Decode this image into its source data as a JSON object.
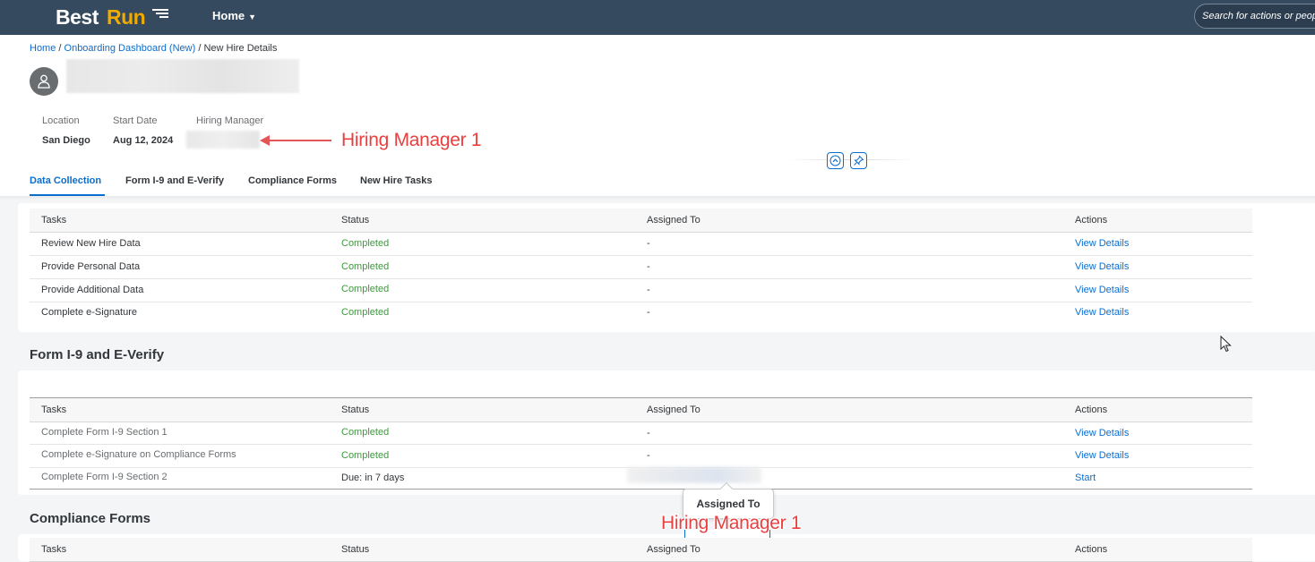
{
  "shell": {
    "logo_best": "Best",
    "logo_run": "Run",
    "home_label": "Home",
    "search_placeholder": "Search for actions or people"
  },
  "breadcrumb": {
    "home": "Home",
    "sep1": " / ",
    "dashboard": "Onboarding Dashboard (New)",
    "sep2": " / ",
    "current": "New Hire Details"
  },
  "attributes": {
    "location_label": "Location",
    "location_value": "San Diego",
    "start_date_label": "Start Date",
    "start_date_value": "Aug 12, 2024",
    "hiring_manager_label": "Hiring Manager"
  },
  "annotations": {
    "header_note": "Hiring Manager 1",
    "tooltip_note": "Hiring Manager 1"
  },
  "tabs": [
    {
      "label": "Data Collection",
      "active": true
    },
    {
      "label": "Form I-9 and E-Verify",
      "active": false
    },
    {
      "label": "Compliance Forms",
      "active": false
    },
    {
      "label": "New Hire Tasks",
      "active": false
    }
  ],
  "columns": {
    "tasks": "Tasks",
    "status": "Status",
    "assigned_to": "Assigned To",
    "actions": "Actions"
  },
  "data_collection": {
    "rows": [
      {
        "task": "Review New Hire Data",
        "status": "Completed",
        "assigned": "-",
        "action": "View Details"
      },
      {
        "task": "Provide Personal Data",
        "status": "Completed",
        "assigned": "-",
        "action": "View Details"
      },
      {
        "task": "Provide Additional Data",
        "status": "Completed",
        "assigned": "-",
        "action": "View Details"
      },
      {
        "task": "Complete e-Signature",
        "status": "Completed",
        "assigned": "-",
        "action": "View Details"
      }
    ]
  },
  "form_i9": {
    "title": "Form I-9 and E-Verify",
    "rows": [
      {
        "task": "Complete Form I-9 Section 1",
        "status": "Completed",
        "assigned": "-",
        "action": "View Details"
      },
      {
        "task": "Complete e-Signature on Compliance Forms",
        "status": "Completed",
        "assigned": "-",
        "action": "View Details"
      },
      {
        "task": "Complete Form I-9 Section 2",
        "status": "Due: in 7 days",
        "assigned": "",
        "action": "Start"
      }
    ]
  },
  "tooltip": {
    "text": "Assigned To"
  },
  "compliance_forms": {
    "title": "Compliance Forms"
  },
  "colors": {
    "shell": "#354a5f",
    "accent": "#0a6ed1",
    "completed": "#3a9c3a",
    "annotation": "#e84040",
    "logo_run": "#f0ab00"
  }
}
